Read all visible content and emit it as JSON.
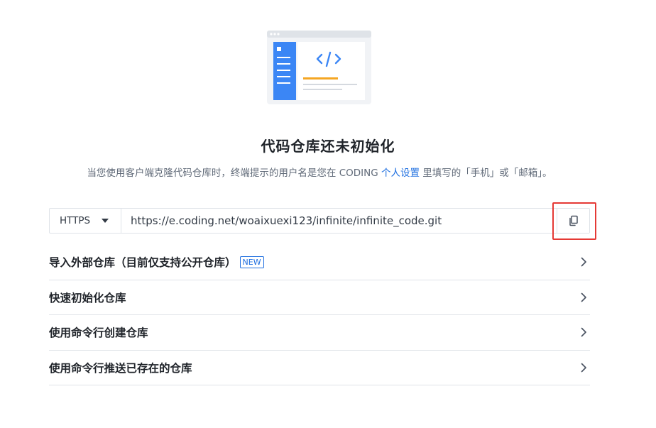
{
  "empty_state": {
    "title": "代码仓库还未初始化",
    "subtitle_before": "当您使用客户端克隆代码仓库时，终端提示的用户名是您在 CODING ",
    "subtitle_link": "个人设置",
    "subtitle_after": " 里填写的「手机」或「邮箱」。"
  },
  "clone": {
    "protocol": "HTTPS",
    "url": "https://e.coding.net/woaixuexi123/infinite/infinite_code.git",
    "copy_icon": "copy-icon"
  },
  "options": [
    {
      "label": "导入外部仓库（目前仅支持公开仓库）",
      "badge": "NEW"
    },
    {
      "label": "快速初始化仓库",
      "badge": ""
    },
    {
      "label": "使用命令行创建仓库",
      "badge": ""
    },
    {
      "label": "使用命令行推送已存在的仓库",
      "badge": ""
    }
  ],
  "colors": {
    "accent": "#1f6fe0",
    "highlight": "#e53935",
    "illus_sidebar": "#3b86f5",
    "illus_underline": "#f5a623"
  }
}
